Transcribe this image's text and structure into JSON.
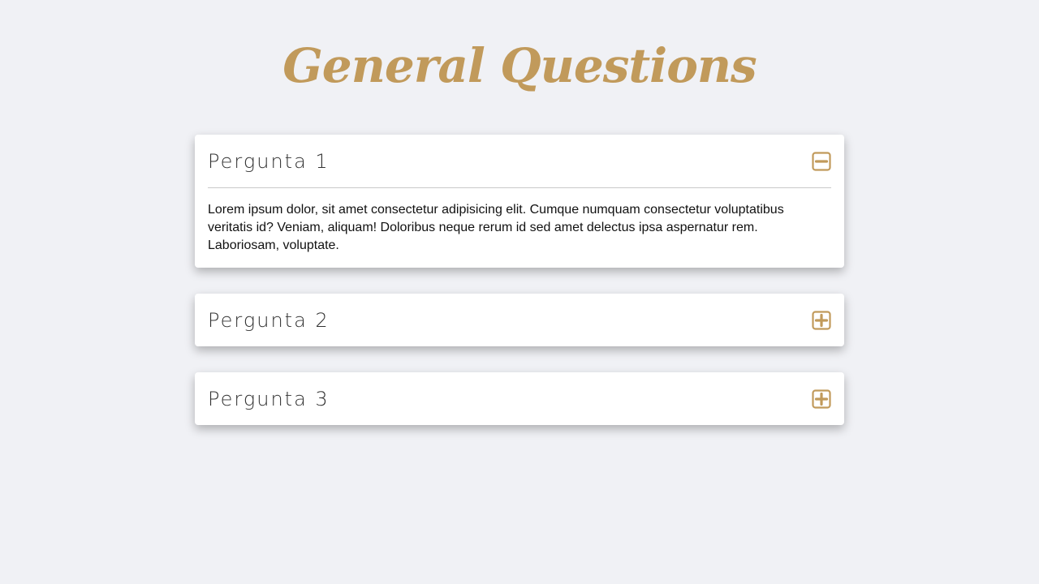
{
  "page": {
    "title": "General Questions"
  },
  "colors": {
    "background": "#f0f1f5",
    "accent": "#c19a5b",
    "card": "#ffffff",
    "question_text": "#333333",
    "answer_text": "#111111"
  },
  "faq": {
    "items": [
      {
        "question": "Pergunta 1",
        "expanded": true,
        "icon": "minus-square-icon",
        "answer": "Lorem ipsum dolor, sit amet consectetur adipisicing elit. Cumque numquam consectetur voluptatibus veritatis id? Veniam, aliquam! Doloribus neque rerum id sed amet delectus ipsa aspernatur rem. Laboriosam, voluptate."
      },
      {
        "question": "Pergunta 2",
        "expanded": false,
        "icon": "plus-square-icon"
      },
      {
        "question": "Pergunta 3",
        "expanded": false,
        "icon": "plus-square-icon"
      }
    ]
  }
}
